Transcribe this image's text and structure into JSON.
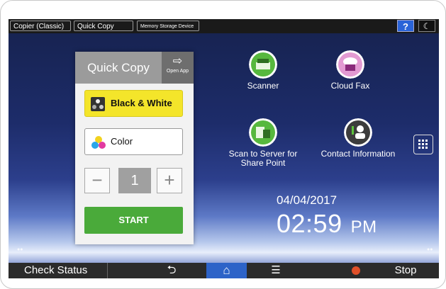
{
  "tabs": [
    {
      "label": "Copier (Classic)"
    },
    {
      "label": "Quick Copy"
    },
    {
      "label": "Memory Storage Device"
    }
  ],
  "topbar": {
    "help_label": "?",
    "night_icon": "moon-icon"
  },
  "widget": {
    "title": "Quick Copy",
    "open_app_label": "Open App",
    "open_app_icon": "open-app-icon",
    "bw_label": "Black & White",
    "color_label": "Color",
    "copies": "1",
    "minus_label": "−",
    "plus_label": "+",
    "start_label": "START"
  },
  "apps": [
    {
      "label": "Scanner",
      "icon": "scanner-icon"
    },
    {
      "label": "Cloud Fax",
      "icon": "cloud-fax-icon"
    },
    {
      "label": "Scan to Server for Share Point",
      "icon": "scan-to-server-icon"
    },
    {
      "label": "Contact Information",
      "icon": "contact-info-icon"
    }
  ],
  "clock": {
    "date": "04/04/2017",
    "time": "02:59",
    "ampm": "PM"
  },
  "bottom": {
    "check_status": "Check Status",
    "back_icon": "back-arrow-icon",
    "home_icon": "home-icon",
    "menu_icon": "menu-icon",
    "stop_label": "Stop"
  },
  "colors": {
    "accent": "#2d63c8",
    "start": "#4aaa3a",
    "bw": "#f4e52a",
    "stop": "#e0502a"
  }
}
